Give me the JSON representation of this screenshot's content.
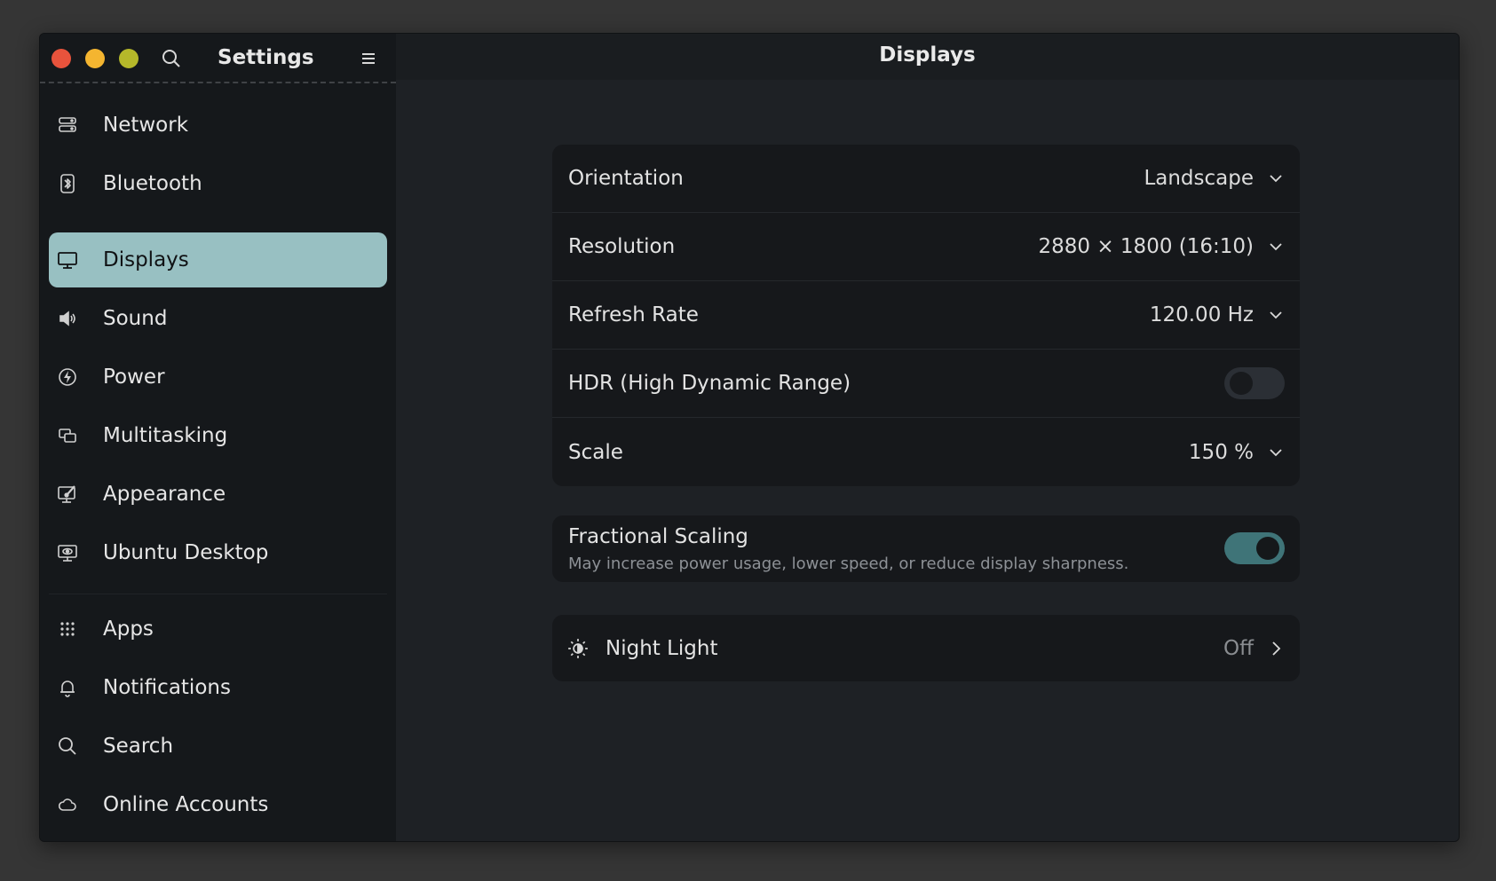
{
  "sidebar": {
    "title": "Settings",
    "items": [
      {
        "label": "Network",
        "icon": "network-icon"
      },
      {
        "label": "Bluetooth",
        "icon": "bluetooth-icon"
      },
      {
        "label": "Displays",
        "icon": "display-icon"
      },
      {
        "label": "Sound",
        "icon": "speaker-icon"
      },
      {
        "label": "Power",
        "icon": "power-icon"
      },
      {
        "label": "Multitasking",
        "icon": "multitasking-icon"
      },
      {
        "label": "Appearance",
        "icon": "appearance-icon"
      },
      {
        "label": "Ubuntu Desktop",
        "icon": "ubuntu-desktop-icon"
      },
      {
        "label": "Apps",
        "icon": "apps-grid-icon"
      },
      {
        "label": "Notifications",
        "icon": "bell-icon"
      },
      {
        "label": "Search",
        "icon": "search-icon"
      },
      {
        "label": "Online Accounts",
        "icon": "cloud-icon"
      }
    ],
    "active": "Displays"
  },
  "main": {
    "title": "Displays",
    "display_settings": {
      "orientation": {
        "label": "Orientation",
        "value": "Landscape"
      },
      "resolution": {
        "label": "Resolution",
        "value": "2880 × 1800 (16:10)"
      },
      "refresh_rate": {
        "label": "Refresh Rate",
        "value": "120.00 Hz"
      },
      "hdr": {
        "label": "HDR (High Dynamic Range)",
        "enabled": false
      },
      "scale": {
        "label": "Scale",
        "value": "150 %"
      }
    },
    "fractional_scaling": {
      "title": "Fractional Scaling",
      "subtitle": "May increase power usage, lower speed, or reduce display sharpness.",
      "enabled": true
    },
    "night_light": {
      "label": "Night Light",
      "value": "Off"
    }
  },
  "colors": {
    "accent": "#98c0c2",
    "toggle_on": "#3f7478",
    "close": "#e8533c",
    "minimize": "#f4b530",
    "maximize": "#b5b82a"
  }
}
